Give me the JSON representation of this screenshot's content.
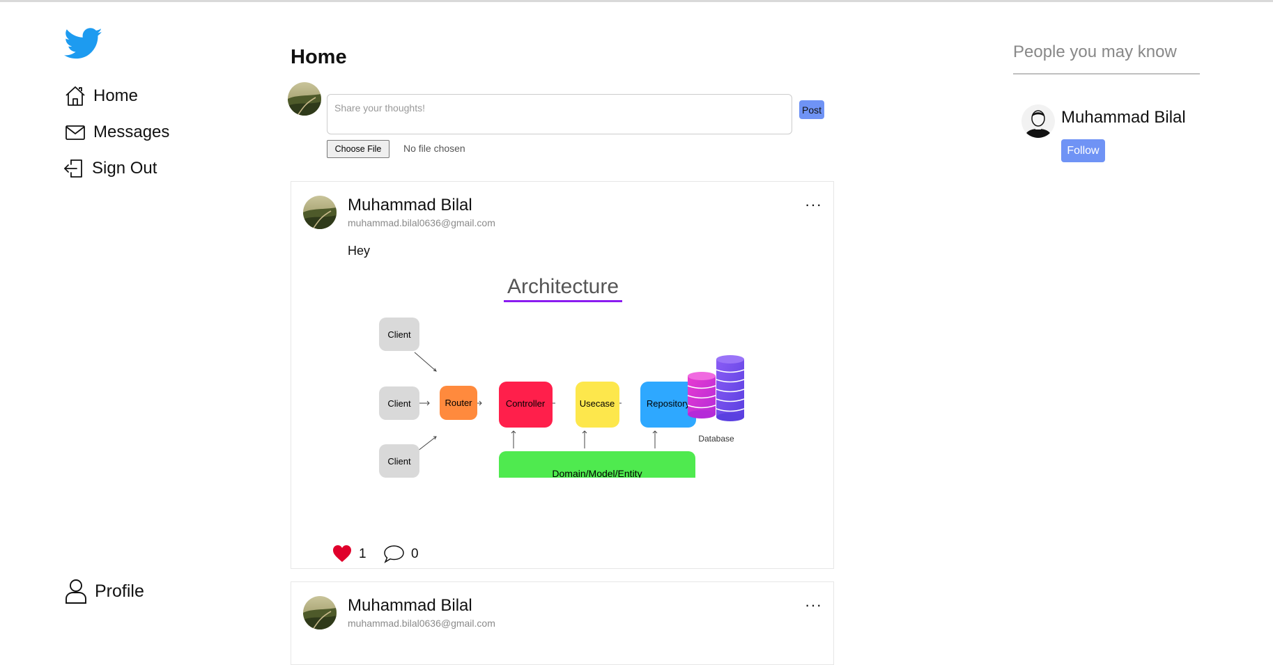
{
  "nav": {
    "home_label": "Home",
    "messages_label": "Messages",
    "signout_label": "Sign Out",
    "profile_label": "Profile"
  },
  "main": {
    "title": "Home",
    "composer": {
      "placeholder": "Share your thoughts!",
      "post_label": "Post",
      "file_button_label": "Choose File",
      "file_status": "No file chosen"
    },
    "posts": [
      {
        "author": "Muhammad Bilal",
        "email": "muhammad.bilal0636@gmail.com",
        "menu": "···",
        "text": "Hey",
        "likes": "1",
        "comments": "0",
        "image": {
          "title": "Architecture",
          "nodes": {
            "client": "Client",
            "router": "Router",
            "controller": "Controller",
            "usecase": "Usecase",
            "repository": "Repository",
            "database": "Database",
            "domain": "Domain/Model/Entity"
          }
        }
      },
      {
        "author": "Muhammad Bilal",
        "email": "muhammad.bilal0636@gmail.com",
        "menu": "···"
      }
    ]
  },
  "suggestions": {
    "title": "People you may know",
    "people": [
      {
        "name": "Muhammad Bilal",
        "follow_label": "Follow"
      }
    ]
  },
  "colors": {
    "brand_blue": "#1d9bf0",
    "button_blue": "#6f93f5",
    "like_red": "#e0002b",
    "router": "#ff8a3d",
    "controller": "#ff1f4b",
    "usecase": "#fde74c",
    "repository": "#2ea8ff",
    "domain": "#4fea4f",
    "client": "#d9d9d9",
    "title_underline": "#8a1cf0"
  },
  "icons": [
    "twitter-bird-icon",
    "home-icon",
    "mail-icon",
    "sign-out-icon",
    "user-icon",
    "heart-icon",
    "comment-icon",
    "more-icon"
  ]
}
